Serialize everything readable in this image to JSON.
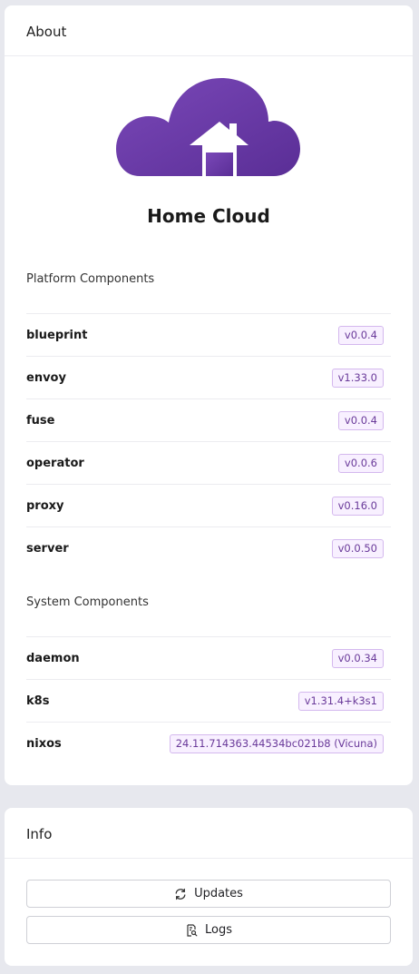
{
  "about": {
    "title": "About",
    "app_name": "Home Cloud",
    "platform": {
      "title": "Platform Components",
      "items": [
        {
          "name": "blueprint",
          "version": "v0.0.4"
        },
        {
          "name": "envoy",
          "version": "v1.33.0"
        },
        {
          "name": "fuse",
          "version": "v0.0.4"
        },
        {
          "name": "operator",
          "version": "v0.0.6"
        },
        {
          "name": "proxy",
          "version": "v0.16.0"
        },
        {
          "name": "server",
          "version": "v0.0.50"
        }
      ]
    },
    "system": {
      "title": "System Components",
      "items": [
        {
          "name": "daemon",
          "version": "v0.0.34"
        },
        {
          "name": "k8s",
          "version": "v1.31.4+k3s1"
        },
        {
          "name": "nixos",
          "version": "24.11.714363.44534bc021b8 (Vicuna)"
        }
      ]
    }
  },
  "info": {
    "title": "Info",
    "updates_label": "Updates",
    "logs_label": "Logs"
  },
  "colors": {
    "logo_purple": "#6a3aa8",
    "badge_text": "#6a3a9a",
    "badge_border": "#d4b8ee"
  },
  "icons": {
    "logo": "cloud-house-icon",
    "updates": "refresh-icon",
    "logs": "document-search-icon"
  }
}
